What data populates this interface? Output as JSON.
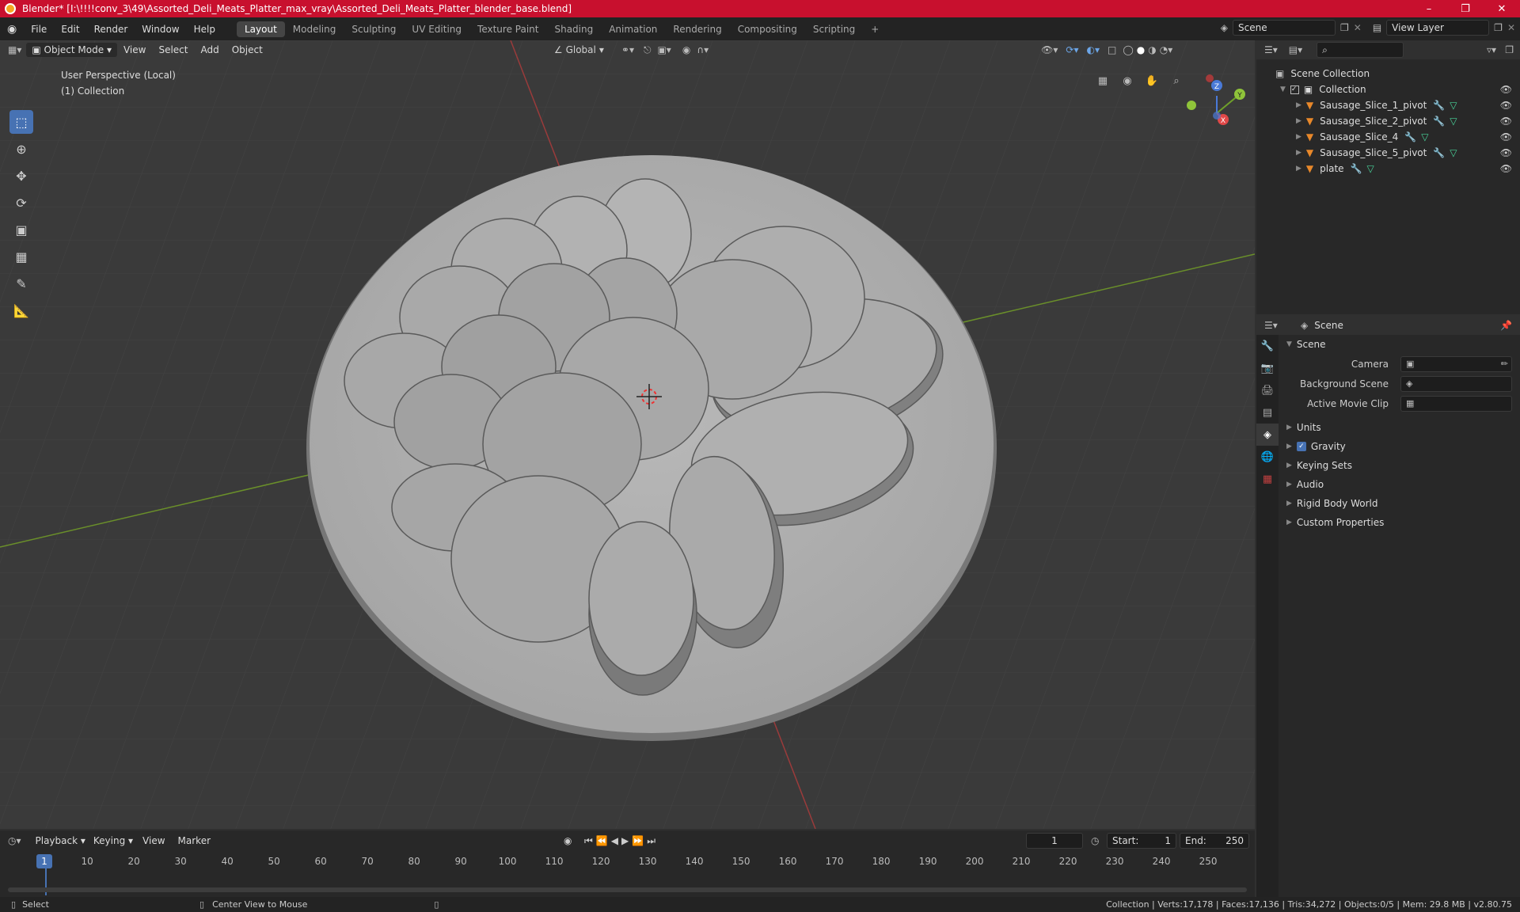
{
  "window": {
    "title": "Blender* [I:\\!!!!conv_3\\49\\Assorted_Deli_Meats_Platter_max_vray\\Assorted_Deli_Meats_Platter_blender_base.blend]"
  },
  "menus": [
    "File",
    "Edit",
    "Render",
    "Window",
    "Help"
  ],
  "workspaces": [
    "Layout",
    "Modeling",
    "Sculpting",
    "UV Editing",
    "Texture Paint",
    "Shading",
    "Animation",
    "Rendering",
    "Compositing",
    "Scripting"
  ],
  "scene_field": "Scene",
  "view_layer_field": "View Layer",
  "viewport": {
    "mode": "Object Mode",
    "menus": [
      "View",
      "Select",
      "Add",
      "Object"
    ],
    "transform": "Global",
    "label_line1": "User Perspective (Local)",
    "label_line2": "(1) Collection",
    "gizmo": {
      "x": "X",
      "y": "Y",
      "z": "Z"
    }
  },
  "outliner": {
    "root": "Scene Collection",
    "collection": "Collection",
    "objects": [
      "Sausage_Slice_1_pivot",
      "Sausage_Slice_2_pivot",
      "Sausage_Slice_4",
      "Sausage_Slice_5_pivot",
      "plate"
    ]
  },
  "properties": {
    "header": "Scene",
    "section": "Scene",
    "camera_label": "Camera",
    "background_label": "Background Scene",
    "movieclip_label": "Active Movie Clip",
    "subsections": [
      "Units",
      "Gravity",
      "Keying Sets",
      "Audio",
      "Rigid Body World",
      "Custom Properties"
    ]
  },
  "timeline": {
    "menus": [
      "Playback",
      "Keying",
      "View",
      "Marker"
    ],
    "current_frame": "1",
    "start_label": "Start:",
    "start": "1",
    "end_label": "End:",
    "end": "250",
    "ticks": [
      "10",
      "20",
      "30",
      "40",
      "50",
      "60",
      "70",
      "80",
      "90",
      "100",
      "110",
      "120",
      "130",
      "140",
      "150",
      "160",
      "170",
      "180",
      "190",
      "200",
      "210",
      "220",
      "230",
      "240",
      "250"
    ]
  },
  "status": {
    "select": "Select",
    "center": "Center View to Mouse",
    "stats": "Collection | Verts:17,178 | Faces:17,136 | Tris:34,272 | Objects:0/5 | Mem: 29.8 MB | v2.80.75"
  }
}
